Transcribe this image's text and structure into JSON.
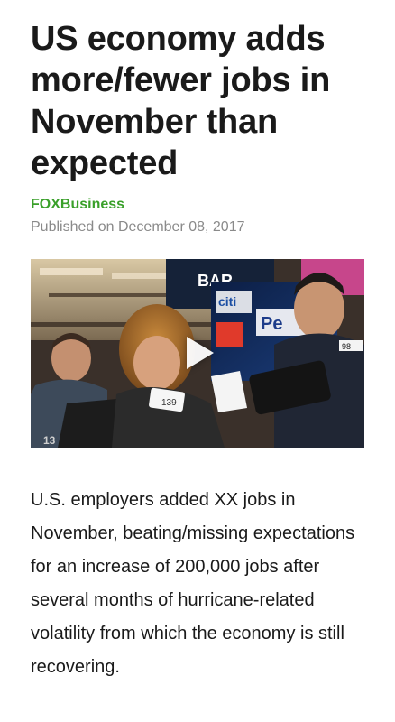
{
  "article": {
    "headline": "US economy adds more/fewer jobs in November than expected",
    "source": "FOXBusiness",
    "published": "Published on December 08, 2017",
    "body": "U.S. employers added XX jobs in November, beating/missing expectations for an increase of 200,000 jobs after several months of hurricane-related volatility from which the economy is still recovering."
  },
  "video": {
    "icon": "play-icon",
    "screen_text": {
      "bank_sign": "BAR",
      "citi": "citi",
      "ticker": "Pe",
      "number": "98",
      "badge": "139",
      "corner": "13"
    }
  },
  "colors": {
    "source": "#3aa02a",
    "meta": "#8a8a8a",
    "text": "#1a1a1a"
  }
}
